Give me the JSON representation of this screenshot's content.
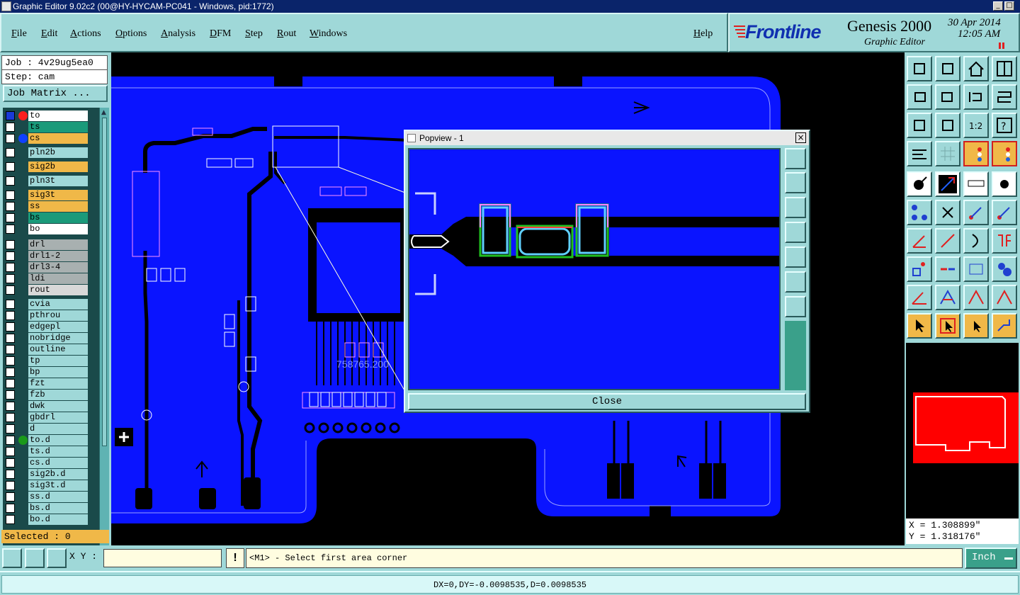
{
  "window": {
    "title": "Graphic Editor 9.02c2 (00@HY-HYCAM-PC041 - Windows, pid:1772)",
    "controls": [
      "_",
      "□",
      "×"
    ]
  },
  "menu": {
    "items": [
      "File",
      "Edit",
      "Actions",
      "Options",
      "Analysis",
      "DFM",
      "Step",
      "Rout",
      "Windows"
    ],
    "help": "Help"
  },
  "brand": {
    "logo": "Frontline",
    "product": "Genesis 2000",
    "subtitle": "Graphic Editor",
    "date": "30 Apr 2014",
    "time": "12:05 AM"
  },
  "job": {
    "job_line": "Job : 4v29ug5ea0",
    "step_line": "Step: cam",
    "matrix_button": "Job Matrix ..."
  },
  "layers": [
    {
      "name": "to",
      "color": "#ffffff",
      "dot": "#ff2020",
      "dotmark": true,
      "active": true
    },
    {
      "name": "ts",
      "color": "#1a9a7a",
      "dot": "",
      "dotmark": false
    },
    {
      "name": "cs",
      "color": "#f0b848",
      "dot": "#1040ff",
      "dotmark": false
    },
    {
      "name": "pln2b",
      "color": "#9fd8d8",
      "dot": "",
      "dotmark": false
    },
    {
      "name": "sig2b",
      "color": "#f0b848",
      "dot": "",
      "dotmark": false
    },
    {
      "name": "pln3t",
      "color": "#9fd8d8",
      "dot": "",
      "dotmark": false
    },
    {
      "name": "sig3t",
      "color": "#f0b848",
      "dot": "",
      "dotmark": false
    },
    {
      "name": "ss",
      "color": "#f0b848",
      "dot": "",
      "dotmark": false
    },
    {
      "name": "bs",
      "color": "#1a9a7a",
      "dot": "",
      "dotmark": false
    },
    {
      "name": "bo",
      "color": "#ffffff",
      "dot": "",
      "dotmark": false
    },
    {
      "name": "drl",
      "color": "#a8b0b0",
      "dot": "",
      "dotmark": false
    },
    {
      "name": "drl1-2",
      "color": "#a8b0b0",
      "dot": "",
      "dotmark": false
    },
    {
      "name": "drl3-4",
      "color": "#a8b0b0",
      "dot": "",
      "dotmark": false
    },
    {
      "name": "ldi",
      "color": "#a8b0b0",
      "dot": "",
      "dotmark": false
    },
    {
      "name": "rout",
      "color": "#d8d8d8",
      "dot": "",
      "dotmark": false
    },
    {
      "name": "cvia",
      "color": "#9fd8d8",
      "dot": "",
      "dotmark": false
    },
    {
      "name": "pthrou",
      "color": "#9fd8d8",
      "dot": "",
      "dotmark": false
    },
    {
      "name": "edgepl",
      "color": "#9fd8d8",
      "dot": "",
      "dotmark": false
    },
    {
      "name": "nobridge",
      "color": "#9fd8d8",
      "dot": "",
      "dotmark": false
    },
    {
      "name": "outline",
      "color": "#9fd8d8",
      "dot": "",
      "dotmark": false
    },
    {
      "name": "tp",
      "color": "#9fd8d8",
      "dot": "",
      "dotmark": false
    },
    {
      "name": "bp",
      "color": "#9fd8d8",
      "dot": "",
      "dotmark": false
    },
    {
      "name": "fzt",
      "color": "#9fd8d8",
      "dot": "",
      "dotmark": false
    },
    {
      "name": "fzb",
      "color": "#9fd8d8",
      "dot": "",
      "dotmark": false
    },
    {
      "name": "dwk",
      "color": "#9fd8d8",
      "dot": "",
      "dotmark": false
    },
    {
      "name": "gbdrl",
      "color": "#9fd8d8",
      "dot": "",
      "dotmark": false
    },
    {
      "name": "d",
      "color": "#9fd8d8",
      "dot": "",
      "dotmark": false
    },
    {
      "name": "to.d",
      "color": "#9fd8d8",
      "dot": "#1a9a1a",
      "dotmark": false
    },
    {
      "name": "ts.d",
      "color": "#9fd8d8",
      "dot": "",
      "dotmark": false
    },
    {
      "name": "cs.d",
      "color": "#9fd8d8",
      "dot": "",
      "dotmark": false
    },
    {
      "name": "sig2b.d",
      "color": "#9fd8d8",
      "dot": "",
      "dotmark": false
    },
    {
      "name": "sig3t.d",
      "color": "#9fd8d8",
      "dot": "",
      "dotmark": false
    },
    {
      "name": "ss.d",
      "color": "#9fd8d8",
      "dot": "",
      "dotmark": false
    },
    {
      "name": "bs.d",
      "color": "#9fd8d8",
      "dot": "",
      "dotmark": false
    },
    {
      "name": "bo.d",
      "color": "#9fd8d8",
      "dot": "",
      "dotmark": false
    }
  ],
  "selected": "Selected : 0",
  "canvas": {
    "board_color": "#0a14ff",
    "background": "#000000",
    "part_label": "758765.200"
  },
  "popview": {
    "title": "Popview - 1",
    "close": "Close"
  },
  "coords": {
    "x": "X = 1.308899\"",
    "y": "Y = 1.318176\""
  },
  "command": {
    "xy_label": "X Y :",
    "xy_value": "",
    "prompt": "<M1> - Select first area corner",
    "units": "Inch"
  },
  "status": "DX=0,DY=-0.0098535,D=0.0098535",
  "icons": {
    "row_tools": [
      "home-icon",
      "window-icon",
      "zoom-icon",
      "help-icon"
    ],
    "mode_tools": [
      "select-icon",
      "measure-icon",
      "snap-icon"
    ]
  }
}
